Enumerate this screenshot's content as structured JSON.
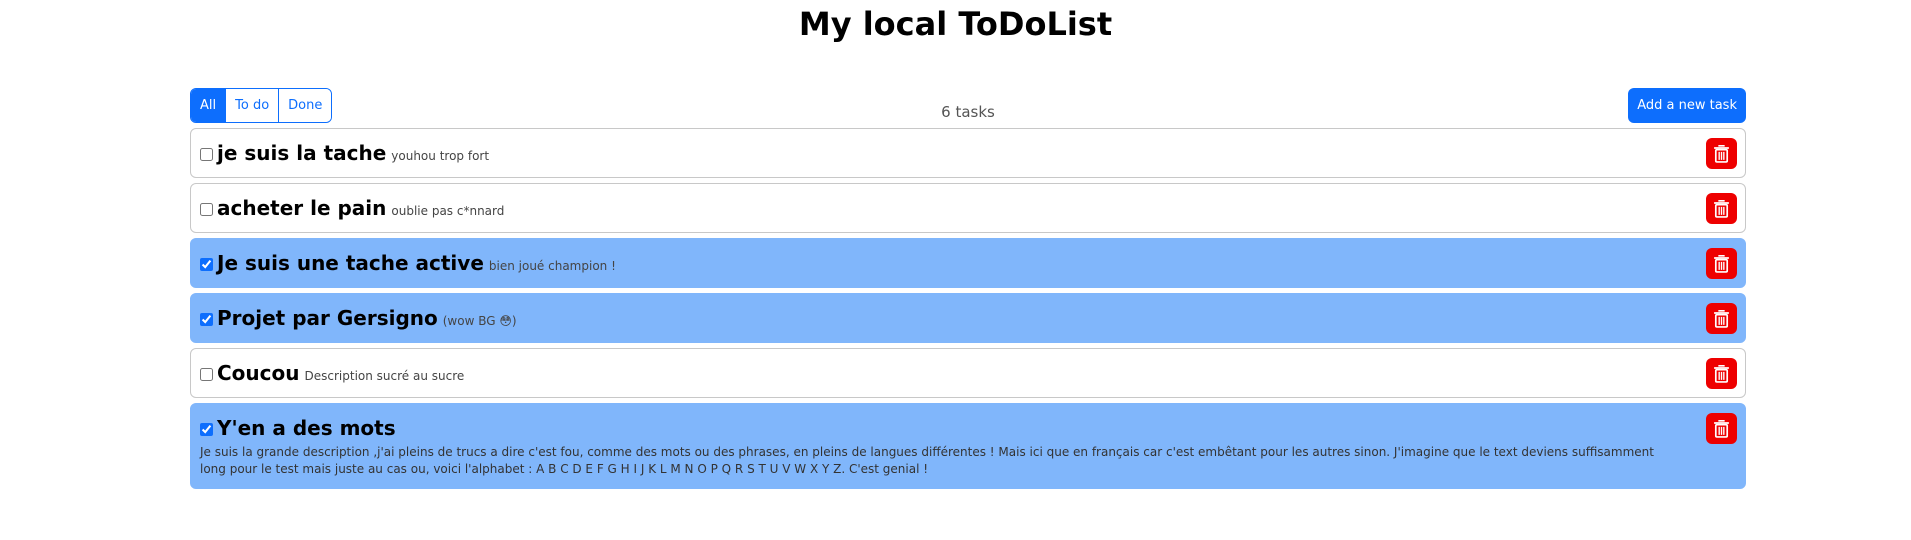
{
  "app": {
    "title": "My local ToDoList"
  },
  "filters": {
    "all": "All",
    "todo": "To do",
    "done": "Done",
    "selected": "All"
  },
  "task_count": "6 tasks",
  "add_button": "Add a new task",
  "colors": {
    "accent": "#0d6efd",
    "done_row": "#80b6fb",
    "delete": "#ee0000"
  },
  "icons": {
    "delete": "trash-icon"
  },
  "tasks": [
    {
      "title": "je suis la tache",
      "description": "youhou trop fort",
      "done": false
    },
    {
      "title": "acheter le pain",
      "description": "oublie pas c*nnard",
      "done": false
    },
    {
      "title": "Je suis une tache active",
      "description": "bien joué champion !",
      "done": true
    },
    {
      "title": "Projet par Gersigno",
      "description": "(wow BG 😳)",
      "done": true
    },
    {
      "title": "Coucou",
      "description": "Description sucré au sucre",
      "done": false
    },
    {
      "title": "Y'en a des mots",
      "description": "Je suis la grande description ,j'ai pleins de trucs a dire c'est fou, comme des mots ou des phrases, en pleins de langues différentes ! Mais ici que en français car c'est embêtant pour les autres sinon. J'imagine que le text deviens suffisamment long pour le test mais juste au cas ou, voici l'alphabet : A B C D E F G H I J K L M N O P Q R S T U V W X Y Z. C'est genial !",
      "done": true
    }
  ]
}
